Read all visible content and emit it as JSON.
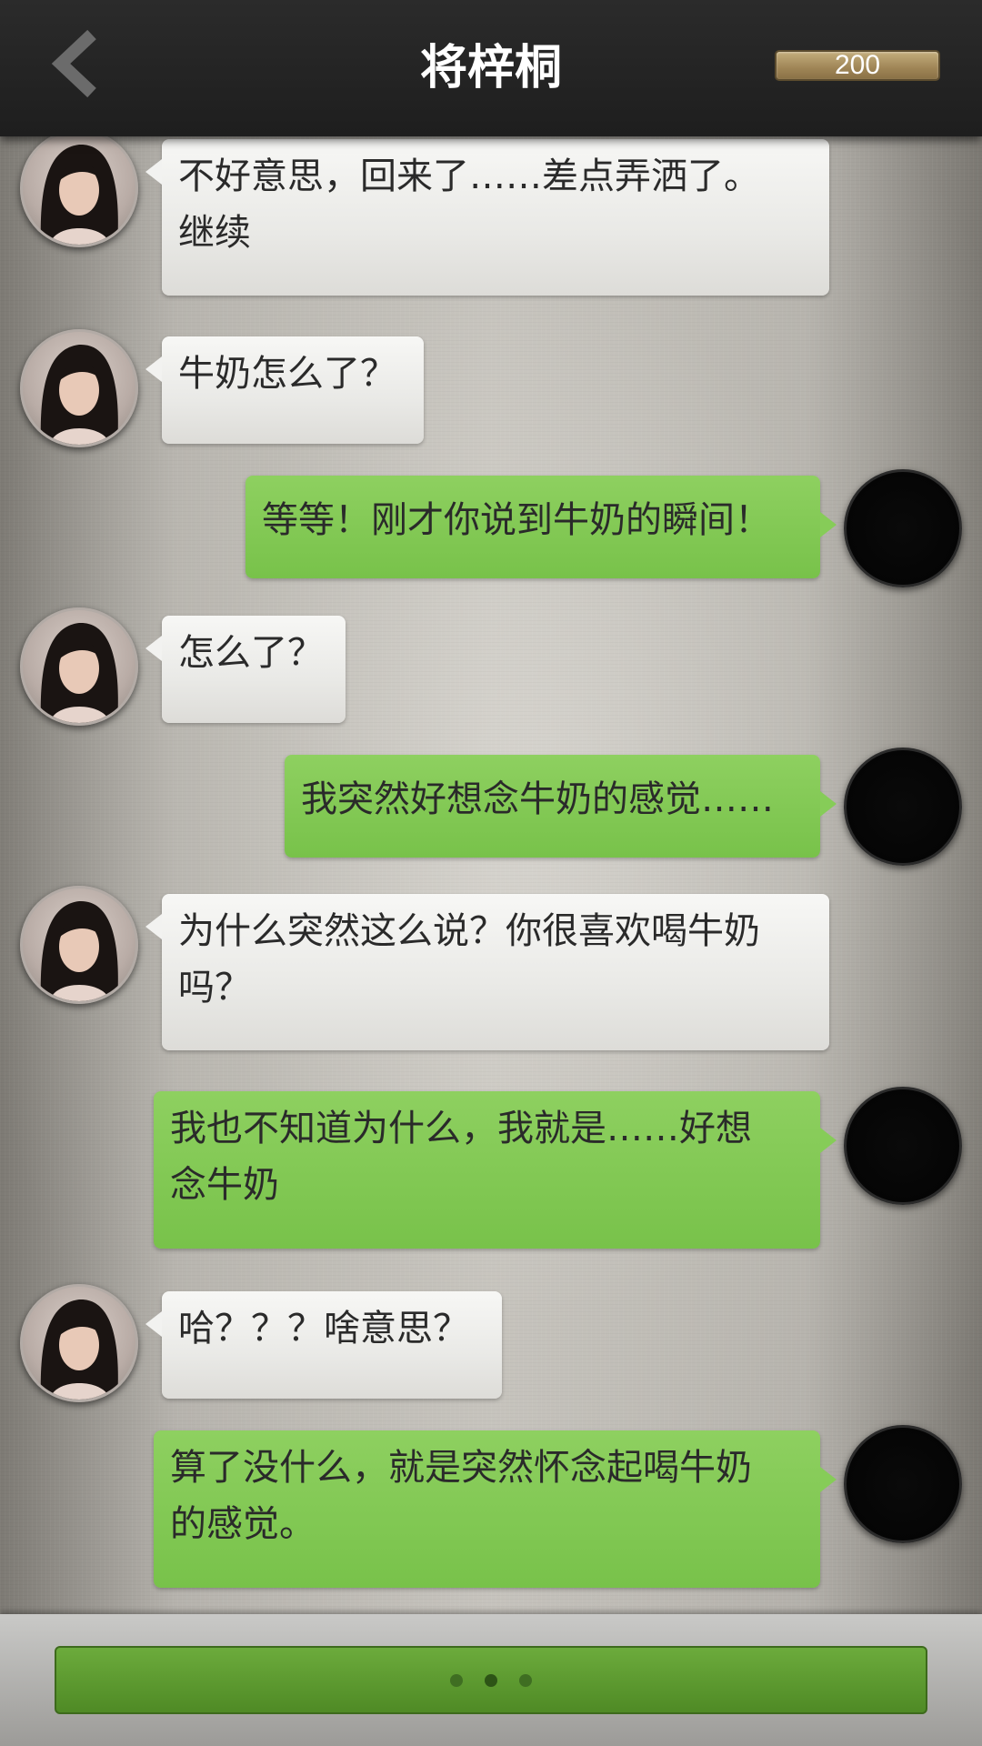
{
  "header": {
    "back_icon": "chevron-left-icon",
    "title": "将梓桐",
    "coins": "200"
  },
  "messages": [
    {
      "from": "her",
      "text": "不好意思，回来了……差点弄洒了。\n继续"
    },
    {
      "from": "her",
      "text": "牛奶怎么了？"
    },
    {
      "from": "me",
      "text": "等等！刚才你说到牛奶的瞬间！"
    },
    {
      "from": "her",
      "text": "怎么了？"
    },
    {
      "from": "me",
      "text": "我突然好想念牛奶的感觉……"
    },
    {
      "from": "her",
      "text": "为什么突然这么说？你很喜欢喝牛奶\n吗？"
    },
    {
      "from": "me",
      "text": "我也不知道为什么，我就是……好想\n念牛奶"
    },
    {
      "from": "her",
      "text": "哈？？？啥意思？"
    },
    {
      "from": "me",
      "text": "算了没什么，就是突然怀念起喝牛奶\n的感觉。"
    }
  ],
  "bottom": {
    "dots": 3
  },
  "colors": {
    "header_bg": "#222222",
    "my_bubble": "#82c853",
    "her_bubble": "#efefed",
    "input_bar": "#5e9b30",
    "coin_bar": "#a89060"
  }
}
